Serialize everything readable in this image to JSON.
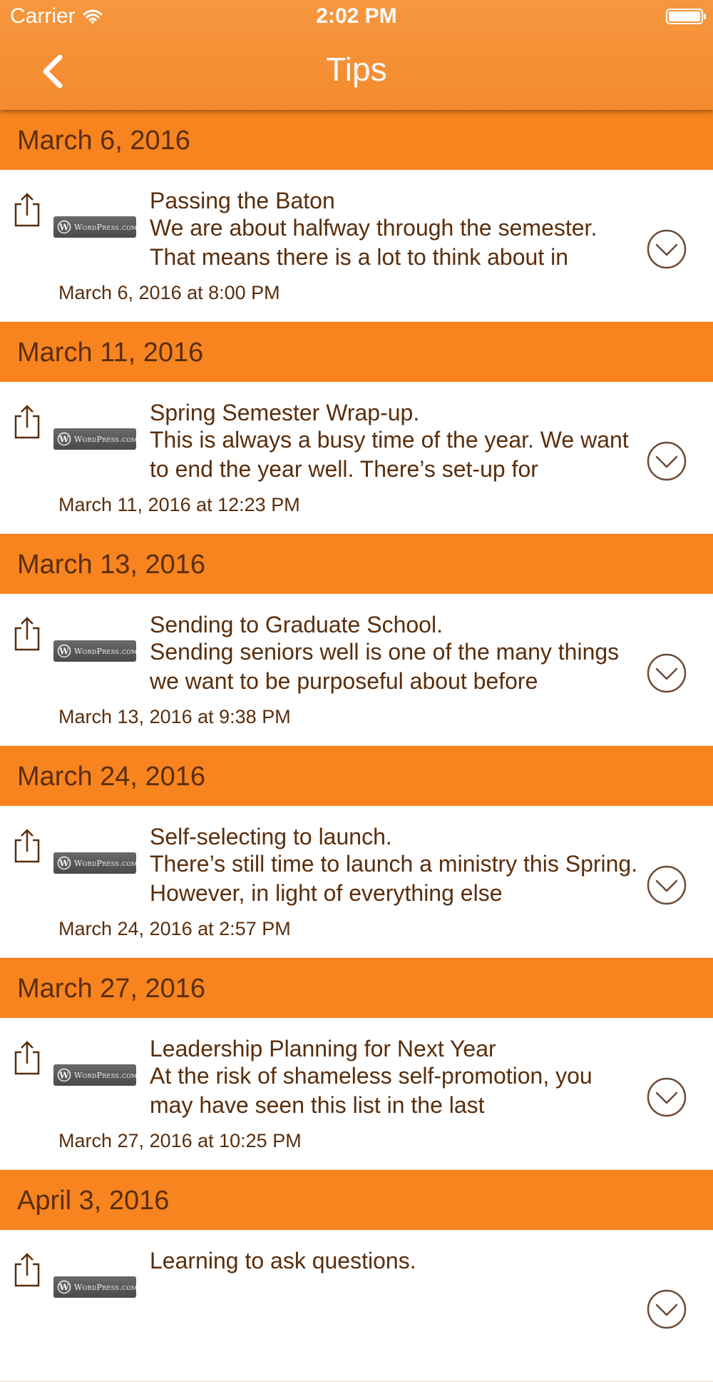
{
  "status_bar": {
    "carrier": "Carrier",
    "time": "2:02 PM"
  },
  "nav": {
    "title": "Tips",
    "back_icon": "chevron-left-icon"
  },
  "colors": {
    "nav_bar": "#f48a2e",
    "section_header": "#f7841f",
    "text": "#5a2e0c",
    "background": "#ffffff"
  },
  "logo_text": "WordPress.com",
  "sections": [
    {
      "header": "March 6, 2016",
      "post": {
        "title": "Passing the Baton",
        "excerpt": "We are about halfway through the semester. That means there is a lot to think about in",
        "date": "March 6, 2016 at 8:00 PM"
      }
    },
    {
      "header": "March 11, 2016",
      "post": {
        "title": "Spring Semester Wrap-up.",
        "excerpt": "This is always a busy time of the year. We want to end the year well. There’s set-up for",
        "date": "March 11, 2016 at 12:23 PM"
      }
    },
    {
      "header": "March 13, 2016",
      "post": {
        "title": "Sending to Graduate School.",
        "excerpt": "Sending seniors well is one of the many things we want to be purposeful about before",
        "date": "March 13, 2016 at 9:38 PM"
      }
    },
    {
      "header": "March 24, 2016",
      "post": {
        "title": "Self-selecting to launch.",
        "excerpt": "There’s still time to launch a ministry this Spring. However, in light of everything else",
        "date": "March 24, 2016 at 2:57 PM"
      }
    },
    {
      "header": "March 27, 2016",
      "post": {
        "title": "Leadership Planning for Next Year",
        "excerpt": "At the risk of shameless self-promotion, you may have seen this list in the last",
        "date": "March 27, 2016 at 10:25 PM"
      }
    },
    {
      "header": "April 3, 2016",
      "post": {
        "title": "Learning to ask questions.",
        "excerpt": "",
        "date": ""
      }
    }
  ]
}
